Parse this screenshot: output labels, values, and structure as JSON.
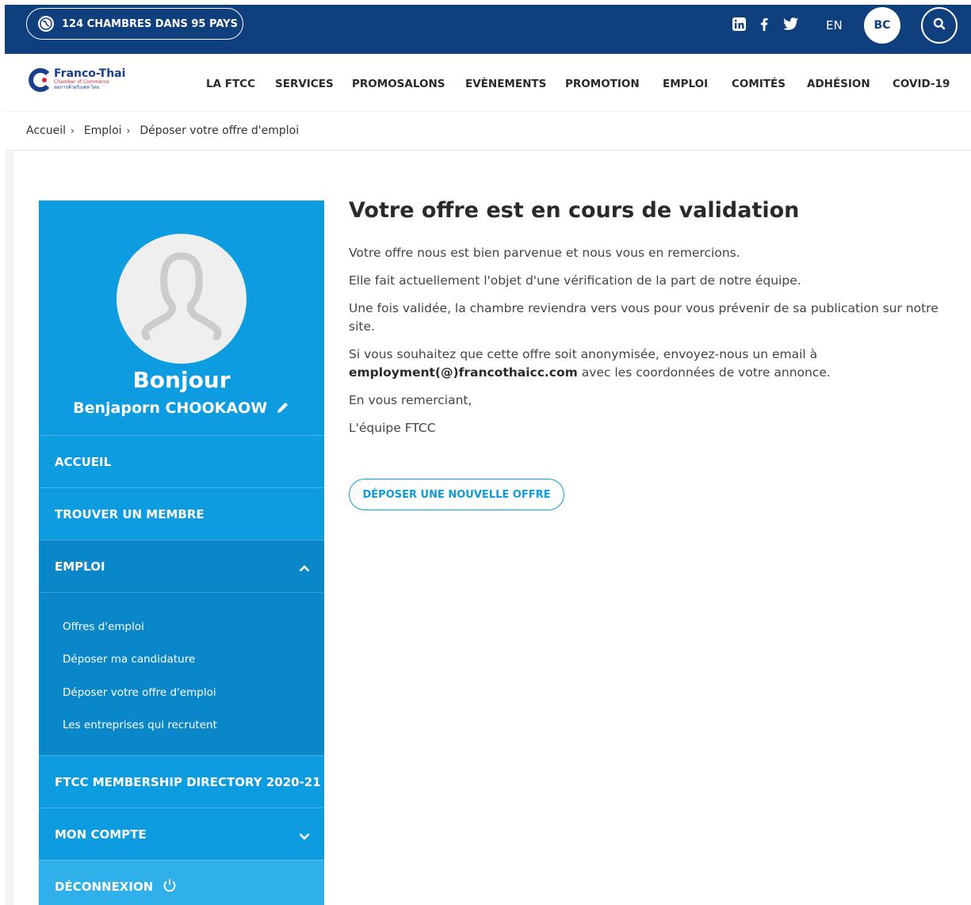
{
  "topbar": {
    "chambers_label": "124 CHAMBRES DANS 95 PAYS",
    "social_icons": [
      "linkedin-icon",
      "facebook-icon",
      "twitter-icon"
    ],
    "lang": "EN",
    "user_initials": "BC",
    "bg_color": "#0f3f7d"
  },
  "logo": {
    "name": "Franco-Thai",
    "subtitle": "Chamber of Commerce",
    "thai": "หอการค้าฝรั่งเศส-ไทย"
  },
  "nav": {
    "items": [
      "LA FTCC",
      "SERVICES",
      "PROMOSALONS",
      "EVÈNEMENTS",
      "PROMOTION",
      "EMPLOI",
      "COMITÉS",
      "ADHÉSION",
      "COVID-19"
    ]
  },
  "breadcrumb": {
    "items": [
      "Accueil",
      "Emploi",
      "Déposer votre offre d'emploi"
    ]
  },
  "sidebar": {
    "hello": "Bonjour",
    "username": "Benjaporn CHOOKAOW",
    "menu": {
      "accueil": "ACCUEIL",
      "trouver": "TROUVER UN MEMBRE",
      "emploi": "EMPLOI",
      "directory": "FTCC MEMBERSHIP DIRECTORY 2020-21",
      "compte": "MON COMPTE",
      "logout": "DÉCONNEXION"
    },
    "submenu": [
      "Offres d'emploi",
      "Déposer ma candidature",
      "Déposer votre offre d'emploi",
      "Les entreprises qui recrutent"
    ],
    "bg_color": "#0d9ce0"
  },
  "main": {
    "title": "Votre offre est en cours de validation",
    "p1": "Votre offre nous est bien parvenue et nous vous en remercions.",
    "p2": "Elle fait actuellement l'objet d'une vérification de la part de notre équipe.",
    "p3": "Une fois validée, la chambre reviendra vers vous pour vous prévenir de sa publication sur notre site.",
    "p4_before": "Si vous souhaitez que cette offre soit anonymisée, envoyez-nous un email à",
    "p4_email": "employment(@)francothaicc.com",
    "p4_after": " avec les coordonnées de votre annonce.",
    "p5": "En vous remerciant,",
    "p6": "L'équipe FTCC",
    "cta": "DÉPOSER UNE NOUVELLE OFFRE"
  }
}
